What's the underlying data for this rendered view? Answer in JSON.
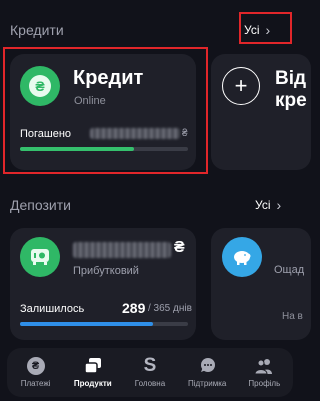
{
  "credits": {
    "section_title": "Кредити",
    "see_all": "Усі",
    "card": {
      "title": "Кредит",
      "subtitle": "Online",
      "progress_label": "Погашено",
      "currency": "₴",
      "progress_fraction": 0.68,
      "progress_color": "#35c06d"
    },
    "open_card": {
      "title_line1": "Від",
      "title_line2": "кре"
    }
  },
  "deposits": {
    "section_title": "Депозити",
    "see_all": "Усі",
    "card": {
      "currency": "₴",
      "subtitle": "Прибутковий",
      "remaining_label": "Залишилось",
      "days_value": "289",
      "days_total": "/ 365 днів",
      "progress_fraction": 0.79,
      "progress_color": "#2f8fe8"
    },
    "savings_card": {
      "title": "Ощад",
      "subtitle": "На в"
    }
  },
  "nav": {
    "items": [
      {
        "label": "Платежі",
        "icon": "hryvnia-icon"
      },
      {
        "label": "Продукти",
        "icon": "products-icon"
      },
      {
        "label": "Головна",
        "icon": "s-logo-icon"
      },
      {
        "label": "Підтримка",
        "icon": "chat-icon"
      },
      {
        "label": "Профіль",
        "icon": "profile-icon"
      }
    ],
    "active": "Продукти"
  },
  "colors": {
    "background": "#11121a",
    "card": "#1f2029",
    "green_accent": "#2fb866",
    "blue_accent": "#35a7e6",
    "highlight_red": "#e1262a"
  }
}
